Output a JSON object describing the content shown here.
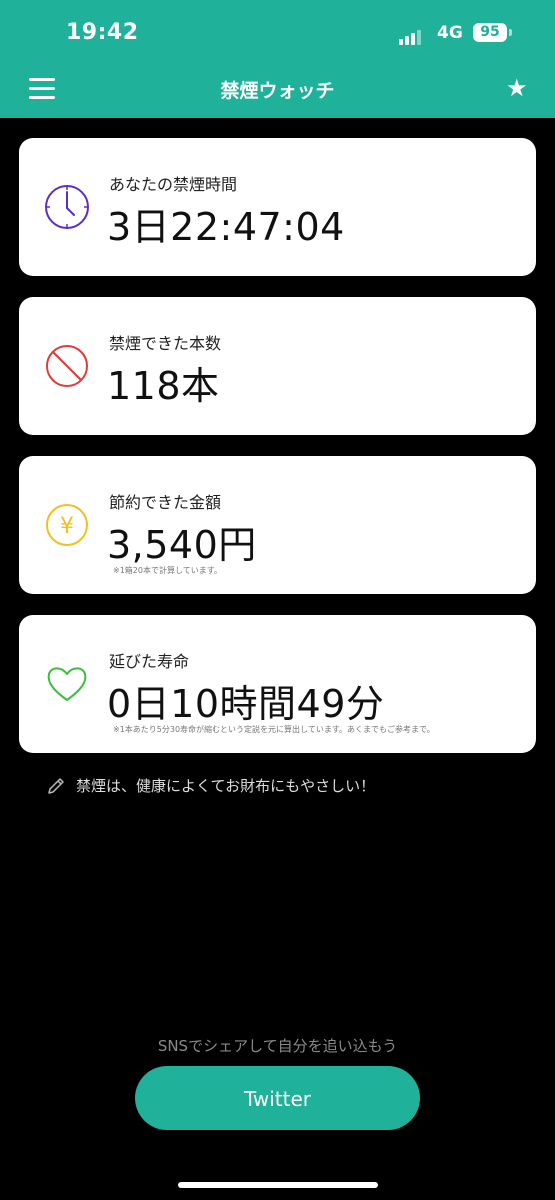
{
  "status_bar": {
    "time": "19:42",
    "network": "4G",
    "battery": "95"
  },
  "nav": {
    "title": "禁煙ウォッチ",
    "menu_icon": "hamburger-menu-icon",
    "star_icon": "star-icon"
  },
  "cards": [
    {
      "label": "あなたの禁煙時間",
      "value": "3日22:47:04",
      "icon": "clock-icon",
      "accent": "#5a2fc2"
    },
    {
      "label": "禁煙できた本数",
      "value": "118本",
      "icon": "no-smoking-icon",
      "accent": "#e03a3a"
    },
    {
      "label": "節約できた金額",
      "value": "3,540円",
      "note": "※1箱20本で計算しています。",
      "icon": "yen-coin-icon",
      "accent": "#f0c020"
    },
    {
      "label": "延びた寿命",
      "value": "0日10時間49分",
      "note": "※1本あたり5分30寿命が縮むという定説を元に算出しています。あくまでもご参考まで。",
      "icon": "heart-icon",
      "accent": "#3bbf3b"
    }
  ],
  "tip": {
    "text": "禁煙は、健康によくてお財布にもやさしい！",
    "icon": "pencil-icon"
  },
  "share": {
    "text": "SNSでシェアして自分を追い込もう",
    "button_label": "Twitter"
  },
  "colors": {
    "primary": "#1fb19a",
    "background": "#000000",
    "card": "#ffffff"
  }
}
